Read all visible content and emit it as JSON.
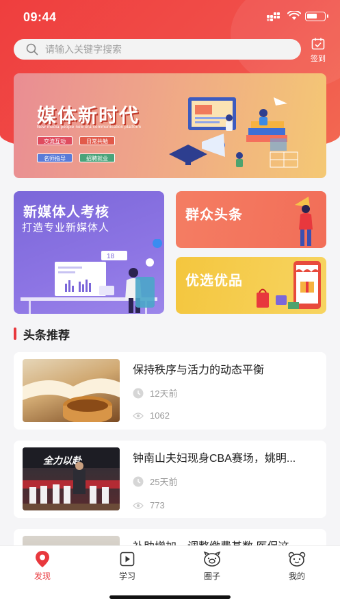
{
  "status_bar": {
    "time": "09:44"
  },
  "search": {
    "placeholder": "请输入关键字搜索"
  },
  "checkin": {
    "label": "签到"
  },
  "banner": {
    "title": "媒体新时代",
    "subtitle": "New media people new era communication platform",
    "tags": [
      "交流互动",
      "日常共勉",
      "名师指导",
      "招聘就业"
    ]
  },
  "cards": {
    "exam": {
      "title": "新媒体人考核",
      "subtitle": "打造专业新媒体人",
      "badge": "18"
    },
    "news": {
      "title": "群众头条"
    },
    "goods": {
      "title": "优选优品"
    }
  },
  "section": {
    "title": "头条推荐"
  },
  "news": [
    {
      "title": "保持秩序与活力的动态平衡",
      "time": "12天前",
      "views": "1062"
    },
    {
      "title": "钟南山夫妇现身CBA赛场，姚明...",
      "time": "25天前",
      "views": "773"
    },
    {
      "title": "补助增加，调整缴费基数 医保这",
      "time": "",
      "views": ""
    }
  ],
  "tabs": [
    {
      "label": "发现",
      "icon": "discover-icon",
      "active": true
    },
    {
      "label": "学习",
      "icon": "video-play-icon",
      "active": false
    },
    {
      "label": "圈子",
      "icon": "pig-face-icon",
      "active": false
    },
    {
      "label": "我的",
      "icon": "bear-face-icon",
      "active": false
    }
  ],
  "colors": {
    "accent": "#e8383d",
    "exam_card": "#8d75e4",
    "news_card": "#f47d63",
    "goods_card": "#f4c63e"
  }
}
